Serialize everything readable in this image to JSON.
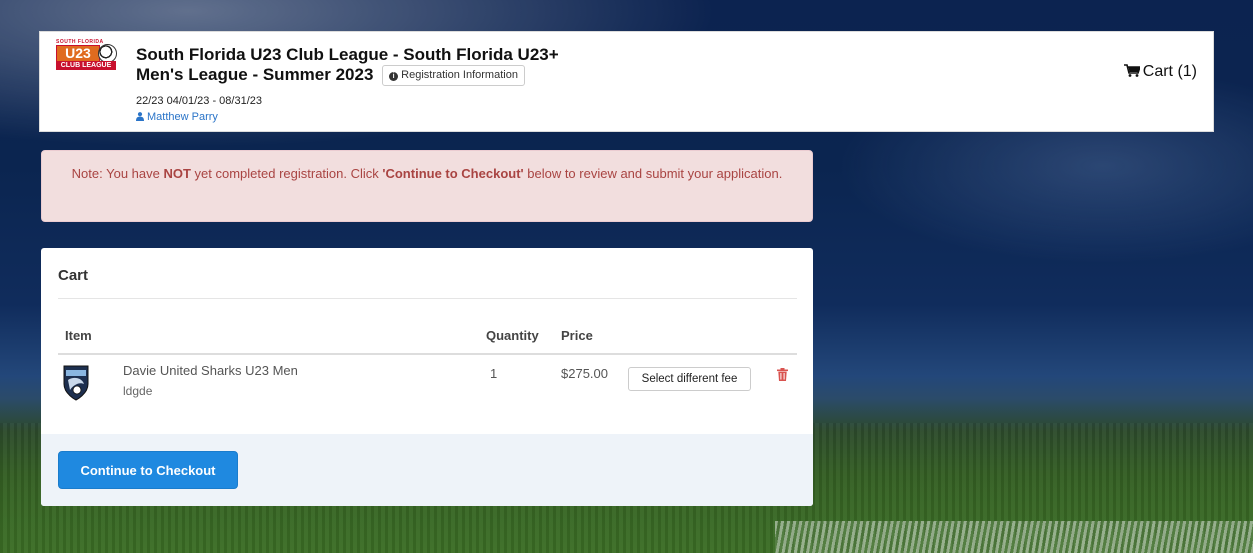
{
  "header": {
    "logo": {
      "top_text": "SOUTH FLORIDA",
      "main_text": "U23",
      "bottom_text": "CLUB LEAGUE"
    },
    "title_line1": "South Florida U23 Club League - South Florida U23+",
    "title_line2": "Men's League - Summer 2023",
    "registration_info_label": "Registration Information",
    "dates": "22/23 04/01/23 - 08/31/23",
    "user_name": "Matthew Parry",
    "cart_label": "Cart (1)"
  },
  "alert": {
    "prefix": "Note: You have ",
    "strong1": "NOT",
    "middle": " yet completed registration. Click ",
    "strong2": "'Continue to Checkout'",
    "suffix": " below to review and submit your application."
  },
  "cart": {
    "title": "Cart",
    "columns": {
      "item": "Item",
      "quantity": "Quantity",
      "price": "Price"
    },
    "items": [
      {
        "name": "Davie United Sharks U23 Men",
        "sub": "ldgde",
        "quantity": "1",
        "price": "$275.00",
        "fee_button": "Select different fee"
      }
    ],
    "checkout_label": "Continue to Checkout"
  },
  "colors": {
    "primary": "#1f89e0",
    "alert_bg": "#f2dede",
    "alert_text": "#a94442",
    "trash": "#d9534f",
    "link": "#2a74c8"
  }
}
